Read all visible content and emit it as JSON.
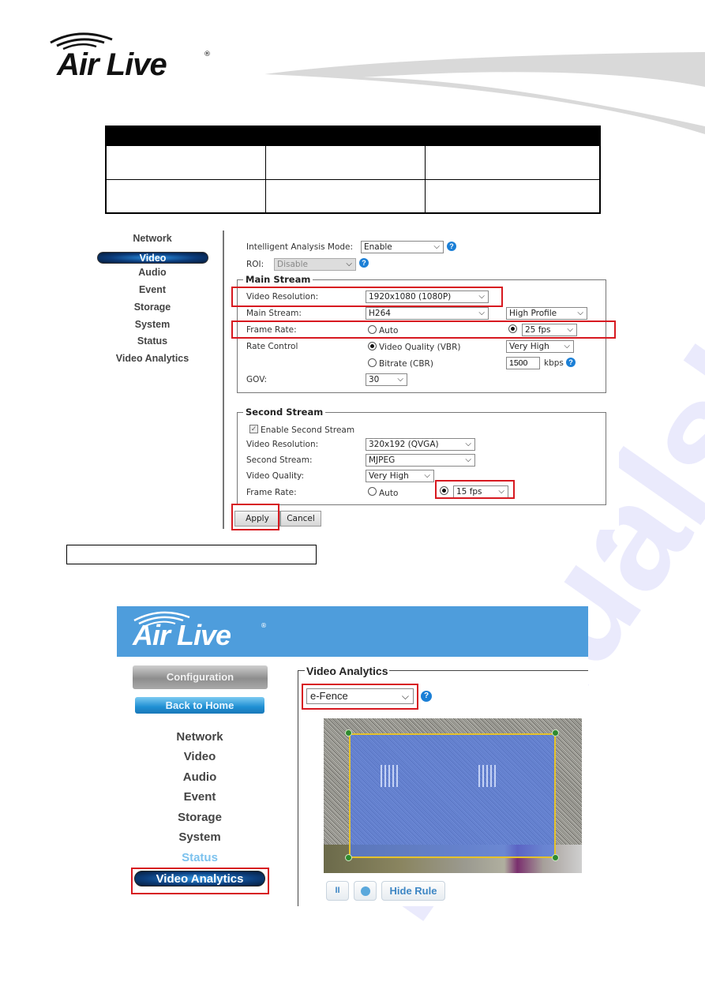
{
  "header": {
    "logo_text": "Air Live",
    "logo_reg": "®"
  },
  "doc_table": {
    "columns": 3,
    "header": [
      "",
      "",
      ""
    ],
    "rows": [
      [
        "",
        "",
        ""
      ],
      [
        "",
        "",
        ""
      ]
    ]
  },
  "screenshot1": {
    "nav": [
      "Network",
      "Video",
      "Audio",
      "Event",
      "Storage",
      "System",
      "Status",
      "Video Analytics"
    ],
    "nav_active": "Video",
    "intelligent_analysis_mode": {
      "label": "Intelligent Analysis Mode:",
      "value": "Enable"
    },
    "roi": {
      "label": "ROI:",
      "value": "Disable"
    },
    "main_stream": {
      "legend": "Main Stream",
      "video_resolution": {
        "label": "Video Resolution:",
        "value": "1920x1080 (1080P)"
      },
      "main_stream": {
        "label": "Main Stream:",
        "codec": "H264",
        "profile": "High Profile"
      },
      "frame_rate": {
        "label": "Frame Rate:",
        "auto_label": "Auto",
        "auto_selected": false,
        "value": "25 fps"
      },
      "rate_control": {
        "label": "Rate Control",
        "vbr_label": "Video Quality (VBR)",
        "vbr_selected": true,
        "vbr_value": "Very High",
        "cbr_label": "Bitrate (CBR)",
        "cbr_value": "1500",
        "cbr_unit": "kbps"
      },
      "gov": {
        "label": "GOV:",
        "value": "30"
      }
    },
    "second_stream": {
      "legend": "Second Stream",
      "enable_label": "Enable Second Stream",
      "enabled": true,
      "video_resolution": {
        "label": "Video Resolution:",
        "value": "320x192 (QVGA)"
      },
      "second_stream": {
        "label": "Second Stream:",
        "value": "MJPEG"
      },
      "video_quality": {
        "label": "Video Quality:",
        "value": "Very High"
      },
      "frame_rate": {
        "label": "Frame Rate:",
        "auto_label": "Auto",
        "auto_selected": false,
        "value": "15 fps"
      }
    },
    "buttons": {
      "apply": "Apply",
      "cancel": "Cancel"
    }
  },
  "caption_box": "",
  "screenshot2": {
    "logo_text": "Air Live",
    "logo_reg": "®",
    "configuration_label": "Configuration",
    "back_home_label": "Back to Home",
    "nav": [
      "Network",
      "Video",
      "Audio",
      "Event",
      "Storage",
      "System",
      "Status",
      "Video Analytics"
    ],
    "nav_active": "Video Analytics",
    "section_title": "Video Analytics",
    "mode_value": "e-Fence",
    "buttons": {
      "pause": "II",
      "snapshot": "",
      "hide_rule": "Hide Rule"
    }
  },
  "colors": {
    "highlight_red": "#d71920",
    "banner_blue": "#4e9ddc",
    "fence_yellow": "#e5c22b",
    "fence_fill": "#5078e6"
  },
  "icons": {
    "help": "?",
    "chevron": "⌄"
  }
}
